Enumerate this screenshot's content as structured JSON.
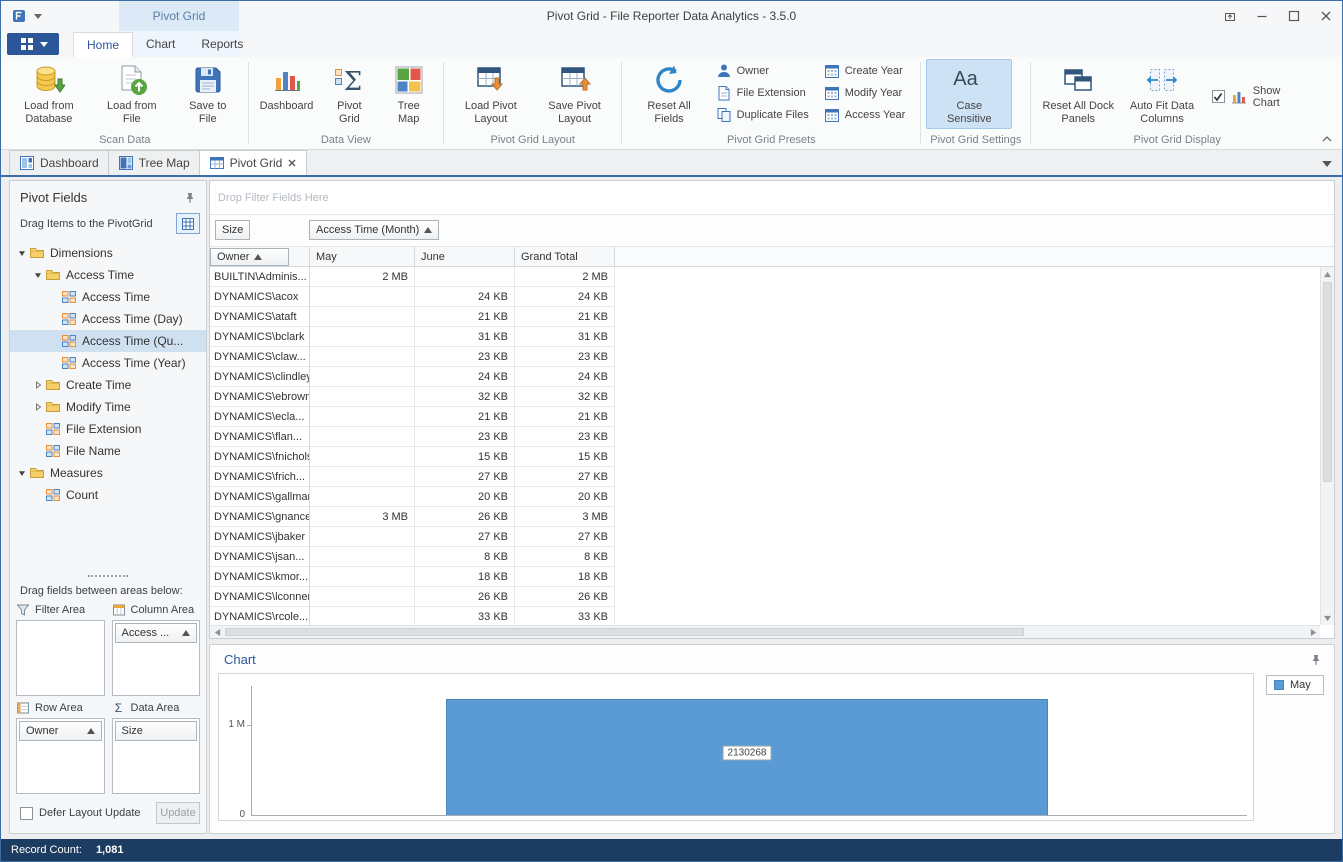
{
  "colors": {
    "accent_blue": "#2b579a",
    "bar_blue": "#5b9bd5",
    "status_bar": "#1d3c61",
    "selection": "#cfe0f1",
    "contextual_tab": "#dce9f7"
  },
  "titlebar": {
    "contextual_group_label": "Pivot Grid",
    "title": "Pivot Grid - File Reporter Data Analytics - 3.5.0"
  },
  "ribbon": {
    "active_tab": "Home",
    "tabs": [
      {
        "label": "Home"
      },
      {
        "label": "Chart",
        "contextual": true
      },
      {
        "label": "Reports",
        "contextual": true
      }
    ],
    "groups": [
      {
        "caption": "Scan Data",
        "items": [
          {
            "type": "big",
            "icon": "load-database-icon",
            "label": "Load from Database"
          },
          {
            "type": "big",
            "icon": "load-file-icon",
            "label": "Load from File"
          },
          {
            "type": "big",
            "icon": "save-file-icon",
            "label": "Save to File"
          }
        ]
      },
      {
        "caption": "Data View",
        "items": [
          {
            "type": "big",
            "icon": "dashboard-icon",
            "label": "Dashboard"
          },
          {
            "type": "big",
            "icon": "pivot-grid-icon",
            "label": "Pivot Grid"
          },
          {
            "type": "big",
            "icon": "tree-map-icon",
            "label": "Tree Map"
          }
        ]
      },
      {
        "caption": "Pivot Grid Layout",
        "items": [
          {
            "type": "big",
            "icon": "load-layout-icon",
            "label": "Load Pivot Layout"
          },
          {
            "type": "big",
            "icon": "save-layout-icon",
            "label": "Save Pivot Layout"
          }
        ]
      },
      {
        "caption": "Pivot Grid Presets",
        "items": [
          {
            "type": "big",
            "icon": "reset-fields-icon",
            "label": "Reset All Fields"
          },
          {
            "type": "smallcol",
            "buttons": [
              {
                "icon": "owner-icon",
                "label": "Owner"
              },
              {
                "icon": "file-extension-icon",
                "label": "File Extension"
              },
              {
                "icon": "duplicate-files-icon",
                "label": "Duplicate Files"
              }
            ]
          },
          {
            "type": "smallcol",
            "buttons": [
              {
                "icon": "calendar-icon",
                "label": "Create Year"
              },
              {
                "icon": "calendar-icon",
                "label": "Modify Year"
              },
              {
                "icon": "calendar-icon",
                "label": "Access Year"
              }
            ]
          }
        ]
      },
      {
        "caption": "Pivot Grid Settings",
        "items": [
          {
            "type": "big",
            "icon": "case-sensitive-icon",
            "label": "Case Sensitive",
            "active": true,
            "wide": true
          }
        ]
      },
      {
        "caption": "Pivot Grid Display",
        "items": [
          {
            "type": "big",
            "icon": "reset-dock-icon",
            "label": "Reset All Dock Panels"
          },
          {
            "type": "big",
            "icon": "autofit-icon",
            "label": "Auto Fit Data Columns"
          },
          {
            "type": "check",
            "icon": "show-chart-icon",
            "label": "Show Chart",
            "checked": true
          }
        ]
      }
    ]
  },
  "doc_tabs": [
    {
      "label": "Dashboard",
      "icon": "dashboard-tab-icon"
    },
    {
      "label": "Tree Map",
      "icon": "treemap-tab-icon"
    },
    {
      "label": "Pivot Grid",
      "icon": "pivotgrid-tab-icon",
      "active": true,
      "closable": true
    }
  ],
  "field_list": {
    "title": "Pivot Fields",
    "hint": "Drag Items to the PivotGrid",
    "tree": [
      {
        "label": "Dimensions",
        "type": "folder",
        "expanded": true,
        "level": 0
      },
      {
        "label": "Access Time",
        "type": "folder",
        "expanded": true,
        "level": 1
      },
      {
        "label": "Access Time",
        "type": "field",
        "level": 2
      },
      {
        "label": "Access Time (Day)",
        "type": "field",
        "level": 2
      },
      {
        "label": "Access Time (Qu...",
        "type": "field",
        "level": 2,
        "selected": true
      },
      {
        "label": "Access Time (Year)",
        "type": "field",
        "level": 2
      },
      {
        "label": "Create Time",
        "type": "folder",
        "expanded": false,
        "level": 1
      },
      {
        "label": "Modify Time",
        "type": "folder",
        "expanded": false,
        "level": 1
      },
      {
        "label": "File Extension",
        "type": "field",
        "level": 1
      },
      {
        "label": "File Name",
        "type": "field",
        "level": 1
      },
      {
        "label": "Measures",
        "type": "folder",
        "expanded": true,
        "level": 0
      },
      {
        "label": "Count",
        "type": "field",
        "level": 1
      }
    ],
    "drag_hint": "Drag fields between areas below:",
    "areas": [
      {
        "key": "filter",
        "label": "Filter Area",
        "icon": "filter-icon",
        "fields": []
      },
      {
        "key": "column",
        "label": "Column Area",
        "icon": "column-area-icon",
        "fields": [
          {
            "label": "Access ...",
            "sort": "asc"
          }
        ]
      },
      {
        "key": "row",
        "label": "Row Area",
        "icon": "row-area-icon",
        "fields": [
          {
            "label": "Owner",
            "sort": "asc"
          }
        ]
      },
      {
        "key": "data",
        "label": "Data Area",
        "icon": "data-area-icon",
        "fields": [
          {
            "label": "Size"
          }
        ]
      }
    ],
    "defer_label": "Defer Layout Update",
    "defer_checked": false,
    "update_label": "Update"
  },
  "pivot": {
    "filter_hint": "Drop Filter Fields Here",
    "data_field": {
      "label": "Size"
    },
    "column_field": {
      "label": "Access Time (Month)",
      "sort": "asc"
    },
    "row_field": {
      "label": "Owner",
      "sort": "asc"
    },
    "columns": [
      "May",
      "June",
      "Grand Total"
    ],
    "rows": [
      [
        "BUILTIN\\Adminis...",
        "2 MB",
        "",
        "2 MB"
      ],
      [
        "DYNAMICS\\acox",
        "",
        "24 KB",
        "24 KB"
      ],
      [
        "DYNAMICS\\ataft",
        "",
        "21 KB",
        "21 KB"
      ],
      [
        "DYNAMICS\\bclark",
        "",
        "31 KB",
        "31 KB"
      ],
      [
        "DYNAMICS\\claw...",
        "",
        "23 KB",
        "23 KB"
      ],
      [
        "DYNAMICS\\clindley",
        "",
        "24 KB",
        "24 KB"
      ],
      [
        "DYNAMICS\\ebrown",
        "",
        "32 KB",
        "32 KB"
      ],
      [
        "DYNAMICS\\ecla...",
        "",
        "21 KB",
        "21 KB"
      ],
      [
        "DYNAMICS\\flan...",
        "",
        "23 KB",
        "23 KB"
      ],
      [
        "DYNAMICS\\fnichols",
        "",
        "15 KB",
        "15 KB"
      ],
      [
        "DYNAMICS\\frich...",
        "",
        "27 KB",
        "27 KB"
      ],
      [
        "DYNAMICS\\gallman",
        "",
        "20 KB",
        "20 KB"
      ],
      [
        "DYNAMICS\\gnance",
        "3 MB",
        "26 KB",
        "3 MB"
      ],
      [
        "DYNAMICS\\jbaker",
        "",
        "27 KB",
        "27 KB"
      ],
      [
        "DYNAMICS\\jsan...",
        "",
        "8 KB",
        "8 KB"
      ],
      [
        "DYNAMICS\\kmor...",
        "",
        "18 KB",
        "18 KB"
      ],
      [
        "DYNAMICS\\lconner",
        "",
        "26 KB",
        "26 KB"
      ],
      [
        "DYNAMICS\\rcole...",
        "",
        "33 KB",
        "33 KB"
      ]
    ]
  },
  "chart_panel": {
    "title": "Chart",
    "bar_label": "2130268",
    "y_ticks": [
      "1 M",
      "0"
    ],
    "legend": [
      {
        "label": "May",
        "color": "#5b9bd5"
      }
    ]
  },
  "chart_data": {
    "type": "bar",
    "categories": [
      ""
    ],
    "series": [
      {
        "name": "May",
        "values": [
          2130268
        ]
      }
    ],
    "title": "",
    "xlabel": "",
    "ylabel": "",
    "y_ticks_visible": [
      "0",
      "1 M"
    ],
    "ylim": [
      0,
      2400000
    ],
    "grid": false,
    "legend_position": "top-right",
    "bar_color": "#5b9bd5",
    "bar_label": "2130268"
  },
  "status_bar": {
    "label": "Record Count:",
    "value": "1,081"
  }
}
